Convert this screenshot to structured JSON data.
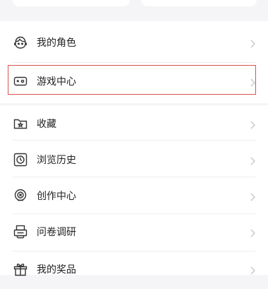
{
  "menu_group_1": {
    "items": [
      {
        "label": "我的角色",
        "icon": "character-face-icon"
      },
      {
        "label": "游戏中心",
        "icon": "game-controller-icon"
      }
    ]
  },
  "menu_group_2": {
    "items": [
      {
        "label": "收藏",
        "icon": "star-folder-icon"
      },
      {
        "label": "浏览历史",
        "icon": "clock-icon"
      },
      {
        "label": "创作中心",
        "icon": "creation-badge-icon"
      },
      {
        "label": "问卷调研",
        "icon": "survey-printer-icon"
      },
      {
        "label": "我的奖品",
        "icon": "gift-icon"
      }
    ]
  },
  "colors": {
    "highlight_border": "#d9534f",
    "chevron": "#c4c4c4",
    "icon_stroke": "#333333"
  }
}
